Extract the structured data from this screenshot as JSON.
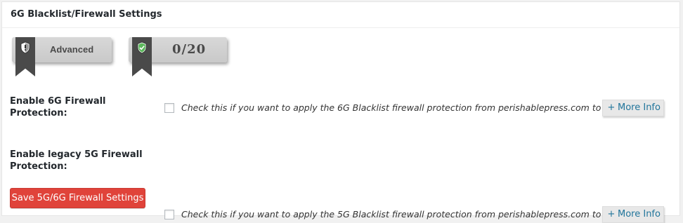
{
  "panel": {
    "title": "6G Blacklist/Firewall Settings"
  },
  "badges": {
    "level": {
      "label": "Advanced",
      "icon": "shield-warning-icon"
    },
    "score": {
      "label": "0/20",
      "icon": "shield-check-icon"
    }
  },
  "rows": [
    {
      "label_line1": "Enable 6G Firewall",
      "label_line2": "Protection:",
      "description": "Check this if you want to apply the 6G Blacklist firewall protection from perishablepress.com to your site.",
      "more_info": "More Info"
    },
    {
      "label_line1": "Enable legacy 5G Firewall",
      "label_line2": "Protection:",
      "description": "Check this if you want to apply the 5G Blacklist firewall protection from perishablepress.com to your site.",
      "more_info": "More Info"
    }
  ],
  "save_button": "Save 5G/6G Firewall Settings",
  "colors": {
    "save_button": "#e0433a",
    "link": "#21759b",
    "ribbon": "#4a4a4a",
    "check_shield": "#5cb85c"
  }
}
